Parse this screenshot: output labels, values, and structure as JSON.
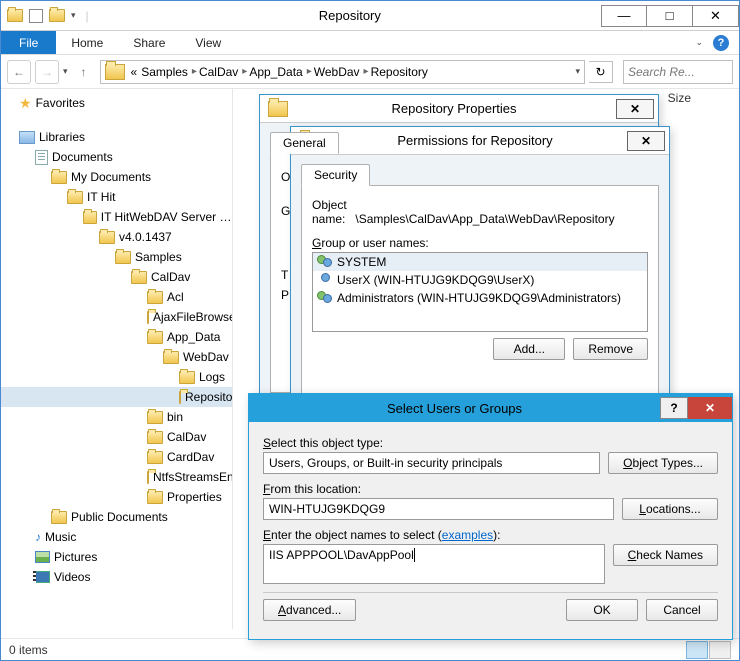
{
  "window": {
    "title": "Repository",
    "min": "—",
    "max": "□",
    "close": "✕"
  },
  "ribbon": {
    "file": "File",
    "tabs": [
      "Home",
      "Share",
      "View"
    ]
  },
  "nav": {
    "crumbs": [
      "Samples",
      "CalDav",
      "App_Data",
      "WebDav",
      "Repository"
    ],
    "search_placeholder": "Search Re...",
    "refresh": "↻"
  },
  "columns": {
    "size": "Size"
  },
  "tree": {
    "favorites": "Favorites",
    "libraries": "Libraries",
    "items": [
      "Documents",
      "My Documents",
      "IT Hit",
      "IT HitWebDAV Server Engine",
      "v4.0.1437",
      "Samples",
      "CalDav",
      "Acl",
      "AjaxFileBrowser",
      "App_Data",
      "WebDav",
      "Logs",
      "Repository",
      "bin",
      "CalDav",
      "CardDav",
      "NtfsStreamsEngine",
      "Properties"
    ],
    "public_docs": "Public Documents",
    "music": "Music",
    "pictures": "Pictures",
    "videos": "Videos"
  },
  "status": {
    "items": "0 items"
  },
  "props_dlg": {
    "title": "Repository Properties",
    "tabs_visible": "General",
    "labels": [
      "Object",
      "Group",
      "Type",
      "Permissions"
    ]
  },
  "perm_dlg": {
    "title": "Permissions for Repository",
    "tab": "Security",
    "object_label": "Object name:",
    "object_value": "\\Samples\\CalDav\\App_Data\\WebDav\\Repository",
    "group_label": "Group or user names:",
    "users": [
      "SYSTEM",
      "UserX (WIN-HTUJG9KDQG9\\UserX)",
      "Administrators (WIN-HTUJG9KDQG9\\Administrators)"
    ],
    "add": "Add...",
    "remove": "Remove"
  },
  "select_dlg": {
    "title": "Select Users or Groups",
    "help": "?",
    "close": "✕",
    "obj_type_label": "Select this object type:",
    "obj_type_value": "Users, Groups, or Built-in security principals",
    "obj_types_btn": "Object Types...",
    "loc_label": "From this location:",
    "loc_value": "WIN-HTUJG9KDQG9",
    "loc_btn": "Locations...",
    "names_label_pre": "Enter the object names to select (",
    "names_label_link": "examples",
    "names_label_post": "):",
    "names_value": "IIS APPPOOL\\DavAppPool",
    "check_btn": "Check Names",
    "advanced": "Advanced...",
    "ok": "OK",
    "cancel": "Cancel"
  }
}
